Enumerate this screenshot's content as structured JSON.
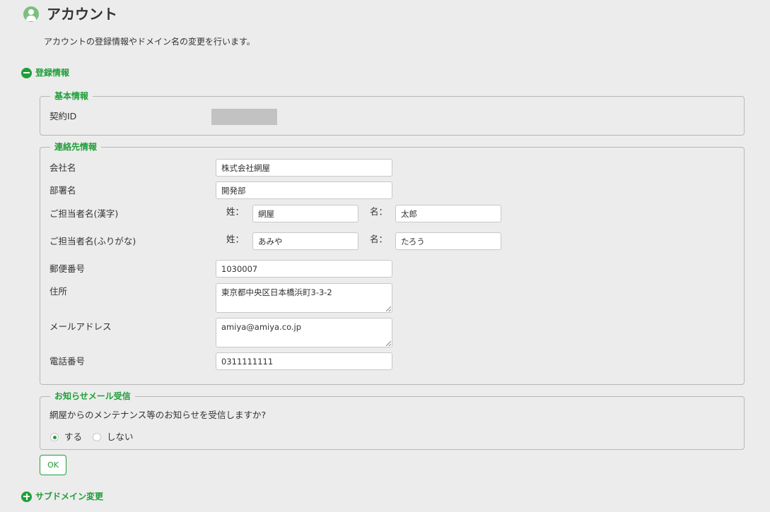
{
  "header": {
    "title": "アカウント",
    "description": "アカウントの登録情報やドメイン名の変更を行います。"
  },
  "sections": {
    "registration_label": "登録情報",
    "subdomain_label": "サブドメイン変更"
  },
  "basic_info": {
    "legend": "基本情報",
    "contract_id_label": "契約ID"
  },
  "contact_info": {
    "legend": "連絡先情報",
    "company_label": "会社名",
    "company_value": "株式会社網屋",
    "department_label": "部署名",
    "department_value": "開発部",
    "name_kanji_label": "ご担当者名(漢字)",
    "name_kana_label": "ご担当者名(ふりがな)",
    "last_name_label": "姓：",
    "first_name_label": "名：",
    "last_kanji_value": "網屋",
    "first_kanji_value": "太郎",
    "last_kana_value": "あみや",
    "first_kana_value": "たろう",
    "postal_label": "郵便番号",
    "postal_value": "1030007",
    "address_label": "住所",
    "address_value": "東京都中央区日本橋浜町3-3-2",
    "email_label": "メールアドレス",
    "email_value": "amiya@amiya.co.jp",
    "phone_label": "電話番号",
    "phone_value": "0311111111"
  },
  "notification": {
    "legend": "お知らせメール受信",
    "question": "網屋からのメンテナンス等のお知らせを受信しますか?",
    "option_yes": "する",
    "option_no": "しない",
    "selected": "する"
  },
  "buttons": {
    "ok": "OK"
  },
  "colors": {
    "accent": "#1f9e3a",
    "background": "#ececec"
  }
}
